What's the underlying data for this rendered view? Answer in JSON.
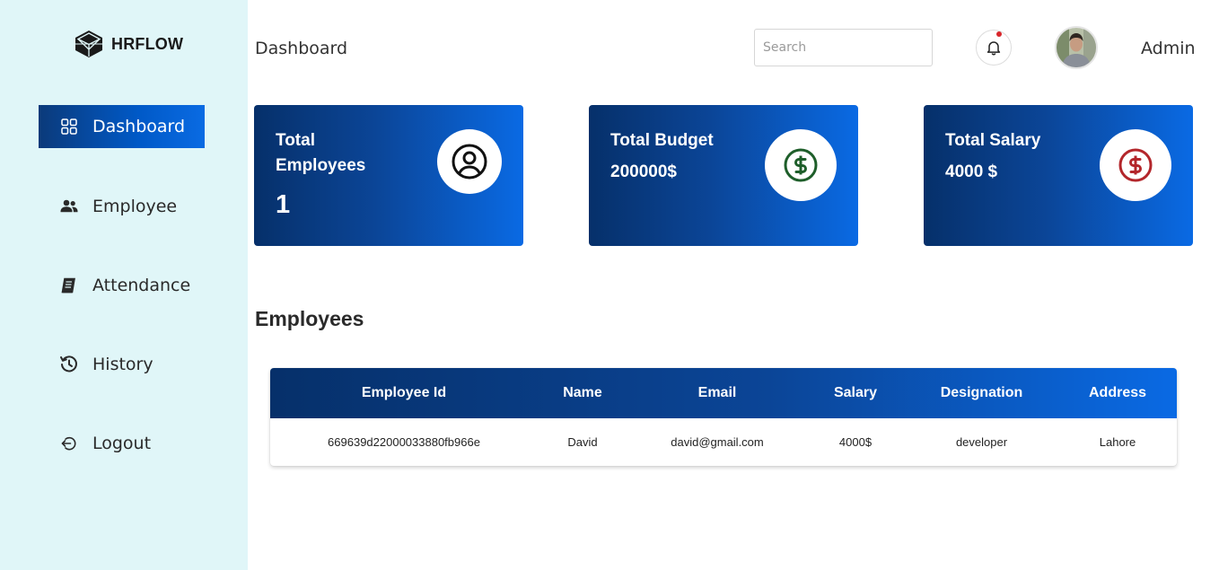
{
  "app": {
    "name": "HRFLOW"
  },
  "sidebar": {
    "items": [
      {
        "label": "Dashboard",
        "icon": "dashboard-grid-icon",
        "active": true
      },
      {
        "label": "Employee",
        "icon": "users-icon",
        "active": false
      },
      {
        "label": "Attendance",
        "icon": "notebook-icon",
        "active": false
      },
      {
        "label": "History",
        "icon": "history-icon",
        "active": false
      },
      {
        "label": "Logout",
        "icon": "logout-icon",
        "active": false
      }
    ]
  },
  "header": {
    "title": "Dashboard",
    "search_placeholder": "Search",
    "search_value": "",
    "user_name": "Admin",
    "notification_indicator_color": "#d8262b"
  },
  "cards": [
    {
      "title": "Total Employees",
      "value": "1",
      "icon": "user-circle-icon",
      "icon_color": "#111111"
    },
    {
      "title": "Total Budget",
      "value": "200000$",
      "icon": "dollar-circle-icon",
      "icon_color": "#1e5e2a"
    },
    {
      "title": "Total Salary",
      "value": "4000 $",
      "icon": "dollar-circle-icon",
      "icon_color": "#b3262b"
    }
  ],
  "employees_section": {
    "title": "Employees",
    "columns": [
      "Employee Id",
      "Name",
      "Email",
      "Salary",
      "Designation",
      "Address"
    ],
    "rows": [
      [
        "669639d22000033880fb966e",
        "David",
        "david@gmail.com",
        "4000$",
        "developer",
        "Lahore"
      ]
    ]
  },
  "colors": {
    "sidebar_bg": "#e0f6f8",
    "accent_dark": "#06306a",
    "accent_light": "#0a6ae4"
  }
}
